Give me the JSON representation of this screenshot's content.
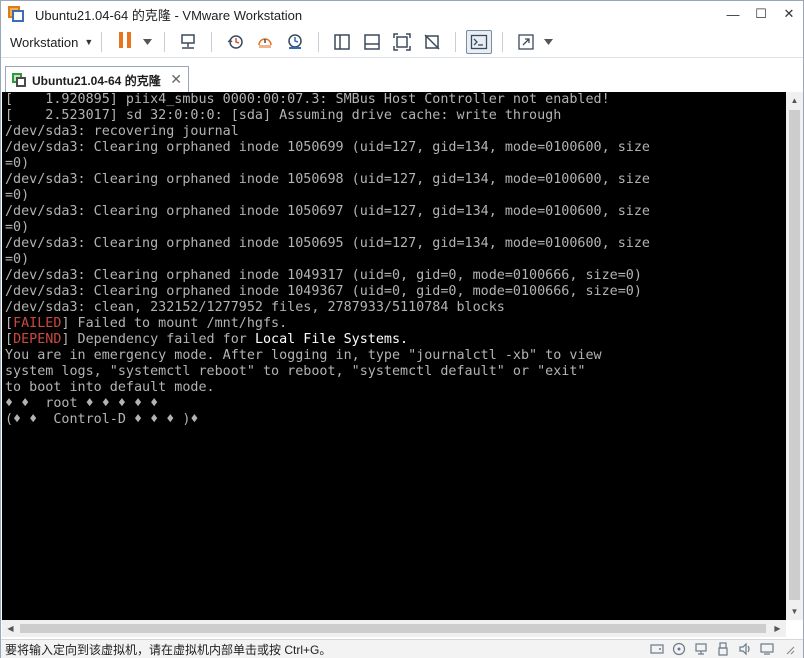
{
  "window": {
    "title": "Ubuntu21.04-64 的克隆 - VMware Workstation",
    "minimize": "—",
    "maximize": "☐",
    "close": "✕"
  },
  "toolbar": {
    "workstation_menu": "Workstation",
    "caret": "▼"
  },
  "tab": {
    "label": "Ubuntu21.04-64 的克隆",
    "close": "✕"
  },
  "console": {
    "lines": [
      "[    1.920895] piix4_smbus 0000:00:07.3: SMBus Host Controller not enabled!",
      "[    2.523017] sd 32:0:0:0: [sda] Assuming drive cache: write through",
      "/dev/sda3: recovering journal",
      "/dev/sda3: Clearing orphaned inode 1050699 (uid=127, gid=134, mode=0100600, size",
      "=0)",
      "/dev/sda3: Clearing orphaned inode 1050698 (uid=127, gid=134, mode=0100600, size",
      "=0)",
      "/dev/sda3: Clearing orphaned inode 1050697 (uid=127, gid=134, mode=0100600, size",
      "=0)",
      "/dev/sda3: Clearing orphaned inode 1050695 (uid=127, gid=134, mode=0100600, size",
      "=0)",
      "/dev/sda3: Clearing orphaned inode 1049317 (uid=0, gid=0, mode=0100666, size=0)",
      "/dev/sda3: Clearing orphaned inode 1049367 (uid=0, gid=0, mode=0100666, size=0)",
      "/dev/sda3: clean, 232152/1277952 files, 2787933/5110784 blocks"
    ],
    "failed_tag": "FAILED",
    "failed_msg": " Failed to mount /mnt/hgfs.",
    "depend_tag": "DEPEND",
    "depend_msg": " Dependency failed for ",
    "depend_target": "Local File Systems.",
    "emergency_lines": [
      "You are in emergency mode. After logging in, type \"journalctl -xb\" to view",
      "system logs, \"systemctl reboot\" to reboot, \"systemctl default\" or \"exit\"",
      "to boot into default mode.",
      "♦ ♦  root ♦ ♦ ♦ ♦ ♦",
      "(♦ ♦  Control-D ♦ ♦ ♦ )♦"
    ]
  },
  "statusbar": {
    "text": "要将输入定向到该虚拟机，请在虚拟机内部单击或按 Ctrl+G。"
  }
}
